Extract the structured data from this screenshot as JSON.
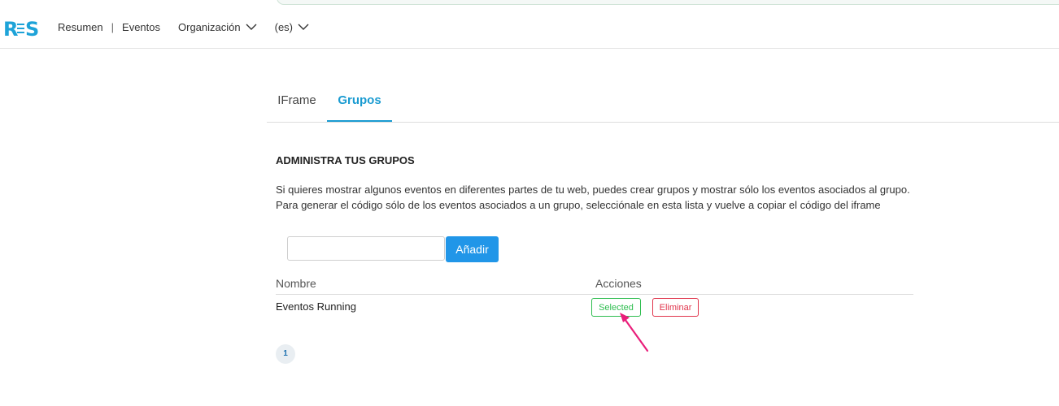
{
  "header": {
    "logo_text": "RES",
    "nav": {
      "resumen": "Resumen",
      "separator": "|",
      "eventos": "Eventos",
      "organizacion": "Organización",
      "language": "(es)"
    }
  },
  "tabs": [
    {
      "label": "IFrame",
      "active": false
    },
    {
      "label": "Grupos",
      "active": true
    }
  ],
  "groups": {
    "title": "ADMINISTRA TUS GRUPOS",
    "description_line1": "Si quieres mostrar algunos eventos en diferentes partes de tu web, puedes crear grupos y mostrar sólo los eventos asociados al grupo.",
    "description_line2": "Para generar el código sólo de los eventos asociados a un grupo, selecciónale en esta lista y vuelve a copiar el código del iframe",
    "input_value": "",
    "add_label": "Añadir",
    "columns": {
      "name": "Nombre",
      "actions": "Acciones"
    },
    "rows": [
      {
        "name": "Eventos Running",
        "selected_label": "Selected",
        "delete_label": "Eliminar"
      }
    ],
    "pagination": {
      "current_page": "1"
    }
  },
  "colors": {
    "accent": "#1a9bd1",
    "primary_button": "#2196e8",
    "selected": "#2ebd4f",
    "delete": "#e0344b",
    "annotation_arrow": "#e91e7a"
  }
}
